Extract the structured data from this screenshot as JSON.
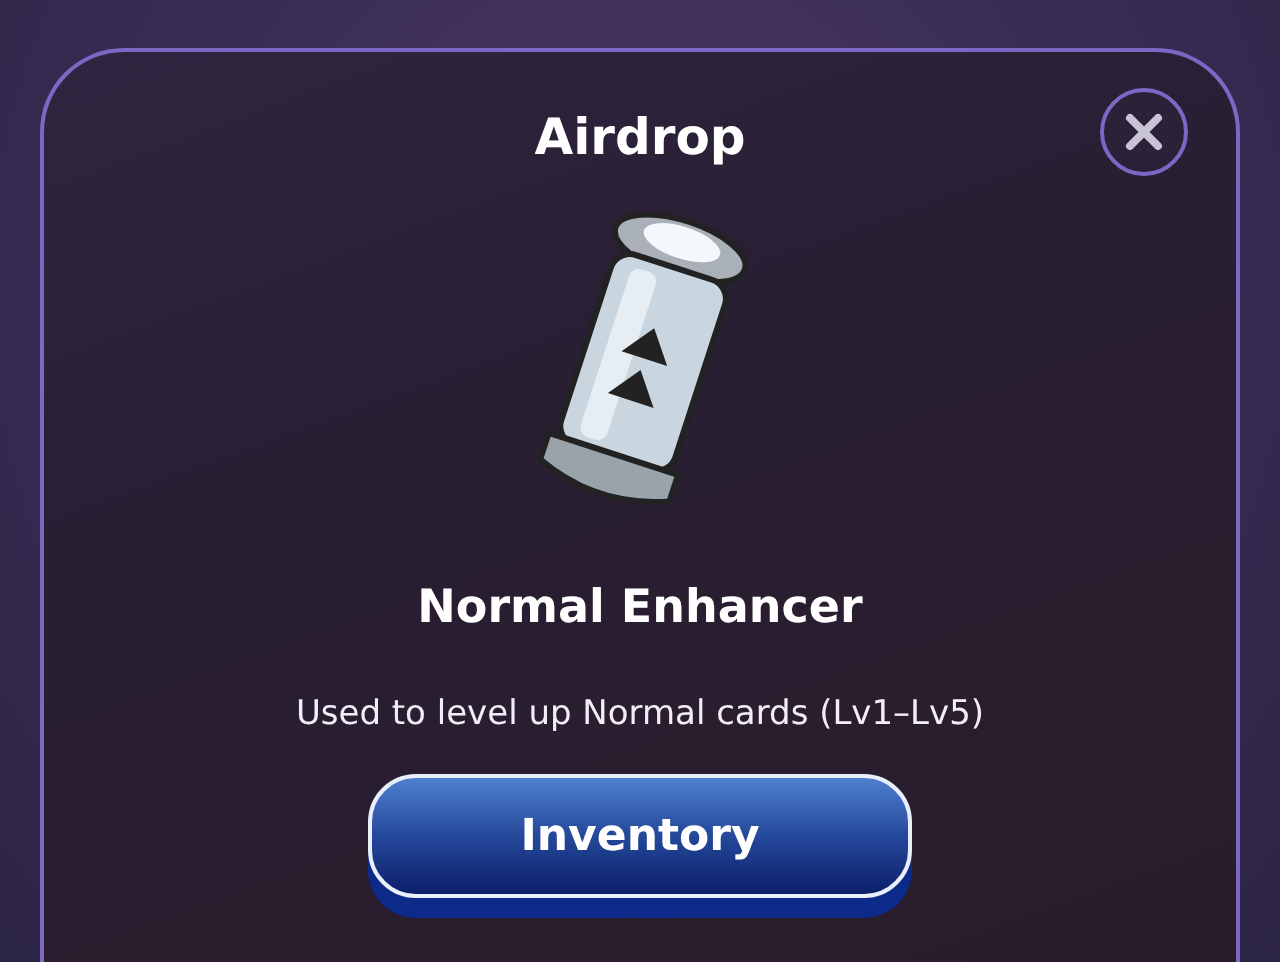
{
  "dialog": {
    "title": "Airdrop",
    "item_name": "Normal Enhancer",
    "description": "Used to level up Normal cards (Lv1–Lv5)",
    "button": "Inventory"
  }
}
